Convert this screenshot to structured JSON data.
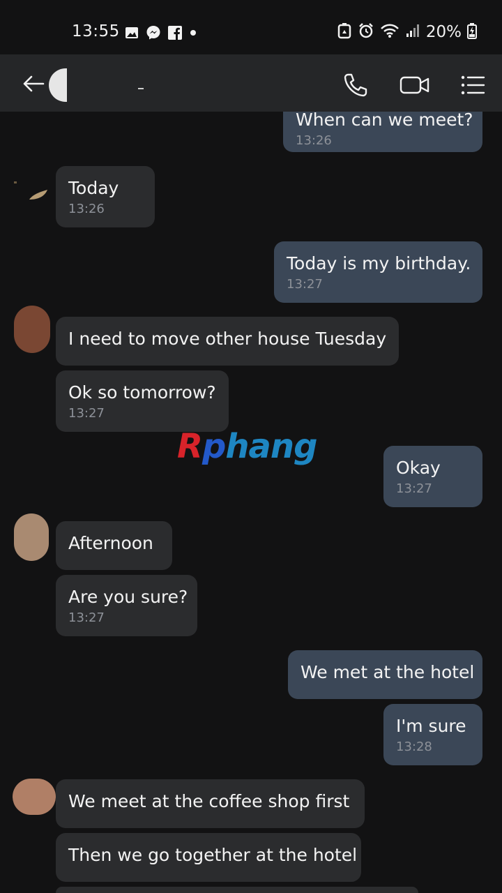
{
  "status_bar": {
    "time": "13:55",
    "battery": "20%",
    "left_icons": [
      "gallery-icon",
      "messenger-icon",
      "facebook-icon",
      "dot-icon"
    ],
    "right_icons": [
      "recycle-icon",
      "alarm-icon",
      "wifi-icon",
      "signal-icon",
      "battery-charging-icon"
    ]
  },
  "header": {
    "icons": [
      "back-arrow-icon",
      "phone-icon",
      "video-call-icon",
      "menu-icon"
    ]
  },
  "watermark": {
    "first": "R",
    "second": "p",
    "rest": "hang"
  },
  "messages": [
    {
      "dir": "out",
      "text": "When can we meet?",
      "time": "13:26"
    },
    {
      "dir": "in",
      "text": "Today",
      "time": "13:26"
    },
    {
      "dir": "out",
      "text": "Today is my birthday.",
      "time": "13:27"
    },
    {
      "dir": "in",
      "text": "I need to move other house Tuesday",
      "time": ""
    },
    {
      "dir": "in",
      "text": "Ok so tomorrow?",
      "time": "13:27"
    },
    {
      "dir": "out",
      "text": "Okay",
      "time": "13:27"
    },
    {
      "dir": "in",
      "text": "Afternoon",
      "time": ""
    },
    {
      "dir": "in",
      "text": "Are you sure?",
      "time": "13:27"
    },
    {
      "dir": "out",
      "text": "We met at the hotel",
      "time": ""
    },
    {
      "dir": "out",
      "text": "I'm sure",
      "time": "13:28"
    },
    {
      "dir": "in",
      "text": "We meet at the coffee shop first",
      "time": ""
    },
    {
      "dir": "in",
      "text": "Then we go together at the hotel",
      "time": ""
    }
  ],
  "colors": {
    "background": "#121213",
    "incoming_bubble": "#2b2c2e",
    "outgoing_bubble": "#3b4757",
    "timestamp": "#8d9198"
  }
}
